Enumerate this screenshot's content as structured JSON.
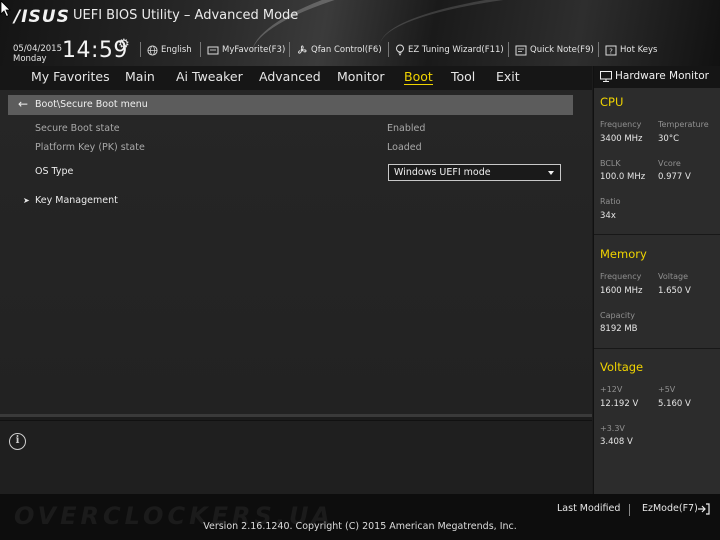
{
  "header": {
    "logo_text": "/ISUS",
    "title": "UEFI BIOS Utility – Advanced Mode",
    "date": "05/04/2015",
    "day": "Monday",
    "time": "14:59",
    "toolbar": [
      {
        "label": "English",
        "icon": "globe-icon"
      },
      {
        "label": "MyFavorite(F3)",
        "icon": "favorite-icon"
      },
      {
        "label": "Qfan Control(F6)",
        "icon": "fan-icon"
      },
      {
        "label": "EZ Tuning Wizard(F11)",
        "icon": "bulb-icon"
      },
      {
        "label": "Quick Note(F9)",
        "icon": "note-icon"
      },
      {
        "label": "Hot Keys",
        "icon": "hotkeys-icon"
      }
    ]
  },
  "nav": {
    "tabs": [
      "My Favorites",
      "Main",
      "Ai Tweaker",
      "Advanced",
      "Monitor",
      "Boot",
      "Tool",
      "Exit"
    ],
    "active": "Boot"
  },
  "main": {
    "breadcrumb": "Boot\\Secure Boot menu",
    "rows": [
      {
        "label": "Secure Boot state",
        "value": "Enabled"
      },
      {
        "label": "Platform Key (PK) state",
        "value": "Loaded"
      }
    ],
    "os_type": {
      "label": "OS Type",
      "value": "Windows UEFI mode"
    },
    "submenu": "Key Management"
  },
  "hardware_monitor": {
    "title": "Hardware Monitor",
    "cpu": {
      "section": "CPU",
      "frequency_label": "Frequency",
      "frequency": "3400 MHz",
      "temperature_label": "Temperature",
      "temperature": "30°C",
      "bclk_label": "BCLK",
      "bclk": "100.0 MHz",
      "vcore_label": "Vcore",
      "vcore": "0.977 V",
      "ratio_label": "Ratio",
      "ratio": "34x"
    },
    "memory": {
      "section": "Memory",
      "frequency_label": "Frequency",
      "frequency": "1600 MHz",
      "voltage_label": "Voltage",
      "voltage": "1.650 V",
      "capacity_label": "Capacity",
      "capacity": "8192 MB"
    },
    "voltage": {
      "section": "Voltage",
      "v12_label": "+12V",
      "v12": "12.192 V",
      "v5_label": "+5V",
      "v5": "5.160 V",
      "v33_label": "+3.3V",
      "v33": "3.408 V"
    }
  },
  "footer": {
    "last_modified": "Last Modified",
    "ezmode": "EzMode(F7)",
    "version": "Version 2.16.1240. Copyright (C) 2015 American Megatrends, Inc.",
    "watermark": "OVERCLOCKERS.UA"
  },
  "colors": {
    "accent": "#f0d400",
    "breadcrumb_bg": "#5c5c5c"
  }
}
